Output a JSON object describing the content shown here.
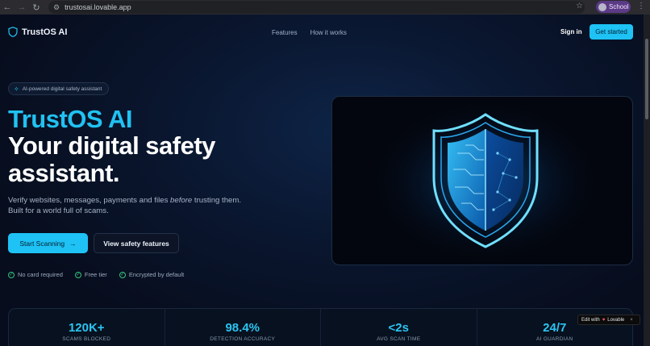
{
  "browser": {
    "url": "trustosai.lovable.app",
    "profile": "School"
  },
  "nav": {
    "brand": "TrustOS AI",
    "links": [
      "Features",
      "How it works"
    ],
    "signin": "Sign in",
    "cta": "Get started"
  },
  "hero": {
    "pill": "AI-powered digital safety assistant",
    "title_accent": "TrustOS AI",
    "title_main": "Your digital safety assistant.",
    "subtitle_pre": "Verify websites, messages, payments and files ",
    "subtitle_em": "before",
    "subtitle_post": " trusting them. Built for a world full of scams.",
    "primary_button": "Start Scanning",
    "secondary_button": "View safety features",
    "checks": [
      "No card required",
      "Free tier",
      "Encrypted by default"
    ]
  },
  "stats": [
    {
      "value": "120K+",
      "label": "SCAMS BLOCKED"
    },
    {
      "value": "98.4%",
      "label": "DETECTION ACCURACY"
    },
    {
      "value": "<2s",
      "label": "AVG SCAN TIME"
    },
    {
      "value": "24/7",
      "label": "AI GUARDIAN"
    }
  ],
  "badge": {
    "text": "Edit with",
    "brand": "Lovable",
    "close": "×"
  },
  "colors": {
    "accent": "#1ec2f5",
    "background": "#070d1d",
    "check": "#34c47c"
  }
}
